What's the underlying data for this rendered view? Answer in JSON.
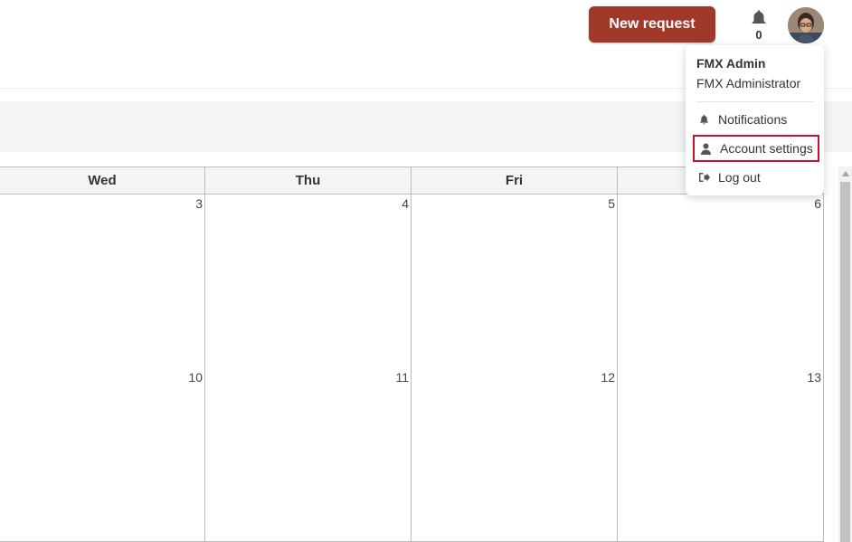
{
  "header": {
    "new_request_label": "New request",
    "notification_count": "0"
  },
  "calendar": {
    "day_names": [
      "Wed",
      "Thu",
      "Fri",
      ""
    ],
    "week1": [
      "3",
      "4",
      "5",
      "6"
    ],
    "week2": [
      "10",
      "11",
      "12",
      "13"
    ]
  },
  "user_menu": {
    "name": "FMX Admin",
    "role": "FMX Administrator",
    "items": [
      {
        "label": "Notifications",
        "icon": "bell-icon"
      },
      {
        "label": "Account settings",
        "icon": "user-icon"
      },
      {
        "label": "Log out",
        "icon": "sign-out-icon"
      }
    ]
  },
  "colors": {
    "brand": "#a0392a",
    "highlight": "#c8102e"
  }
}
